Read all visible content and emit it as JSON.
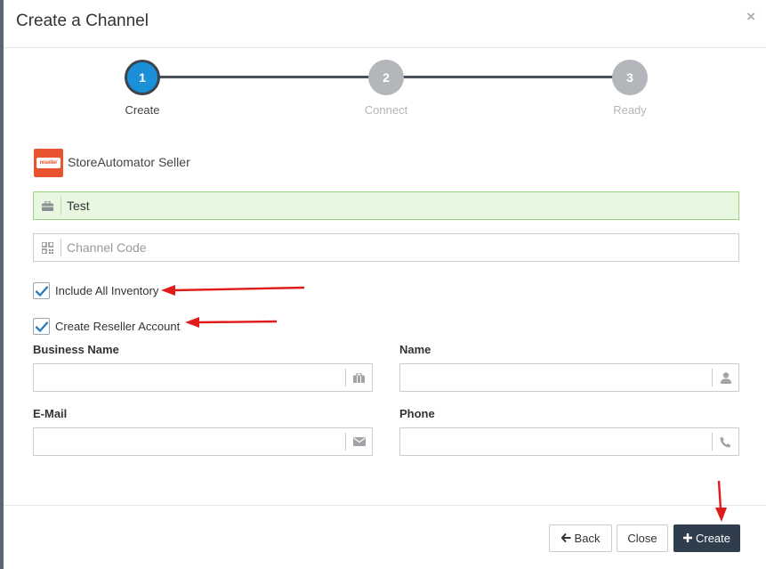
{
  "dialog": {
    "title": "Create a Channel",
    "close_glyph": "×"
  },
  "stepper": {
    "steps": [
      {
        "number": "1",
        "label": "Create",
        "active": true
      },
      {
        "number": "2",
        "label": "Connect",
        "active": false
      },
      {
        "number": "3",
        "label": "Ready",
        "active": false
      }
    ]
  },
  "channel": {
    "logo_text": "reseller",
    "name": "StoreAutomator Seller"
  },
  "form": {
    "channel_name_value": "Test",
    "channel_code_placeholder": "Channel Code",
    "include_inventory_label": "Include All Inventory",
    "include_inventory_checked": true,
    "create_reseller_label": "Create Reseller Account",
    "create_reseller_checked": true,
    "business_name_label": "Business Name",
    "name_label": "Name",
    "email_label": "E-Mail",
    "phone_label": "Phone"
  },
  "footer": {
    "back_label": "Back",
    "close_label": "Close",
    "create_label": "Create"
  },
  "colors": {
    "accent": "#1c8fd9",
    "primary_button": "#2f3d4d",
    "logo": "#e8542f",
    "success_bg": "#e8f8e0",
    "annotation_arrow": "#e01b1b"
  },
  "icons": [
    "briefcase-icon",
    "qrcode-icon",
    "check-icon",
    "user-icon",
    "envelope-icon",
    "phone-icon",
    "arrow-left-icon",
    "plus-icon",
    "close-icon"
  ]
}
